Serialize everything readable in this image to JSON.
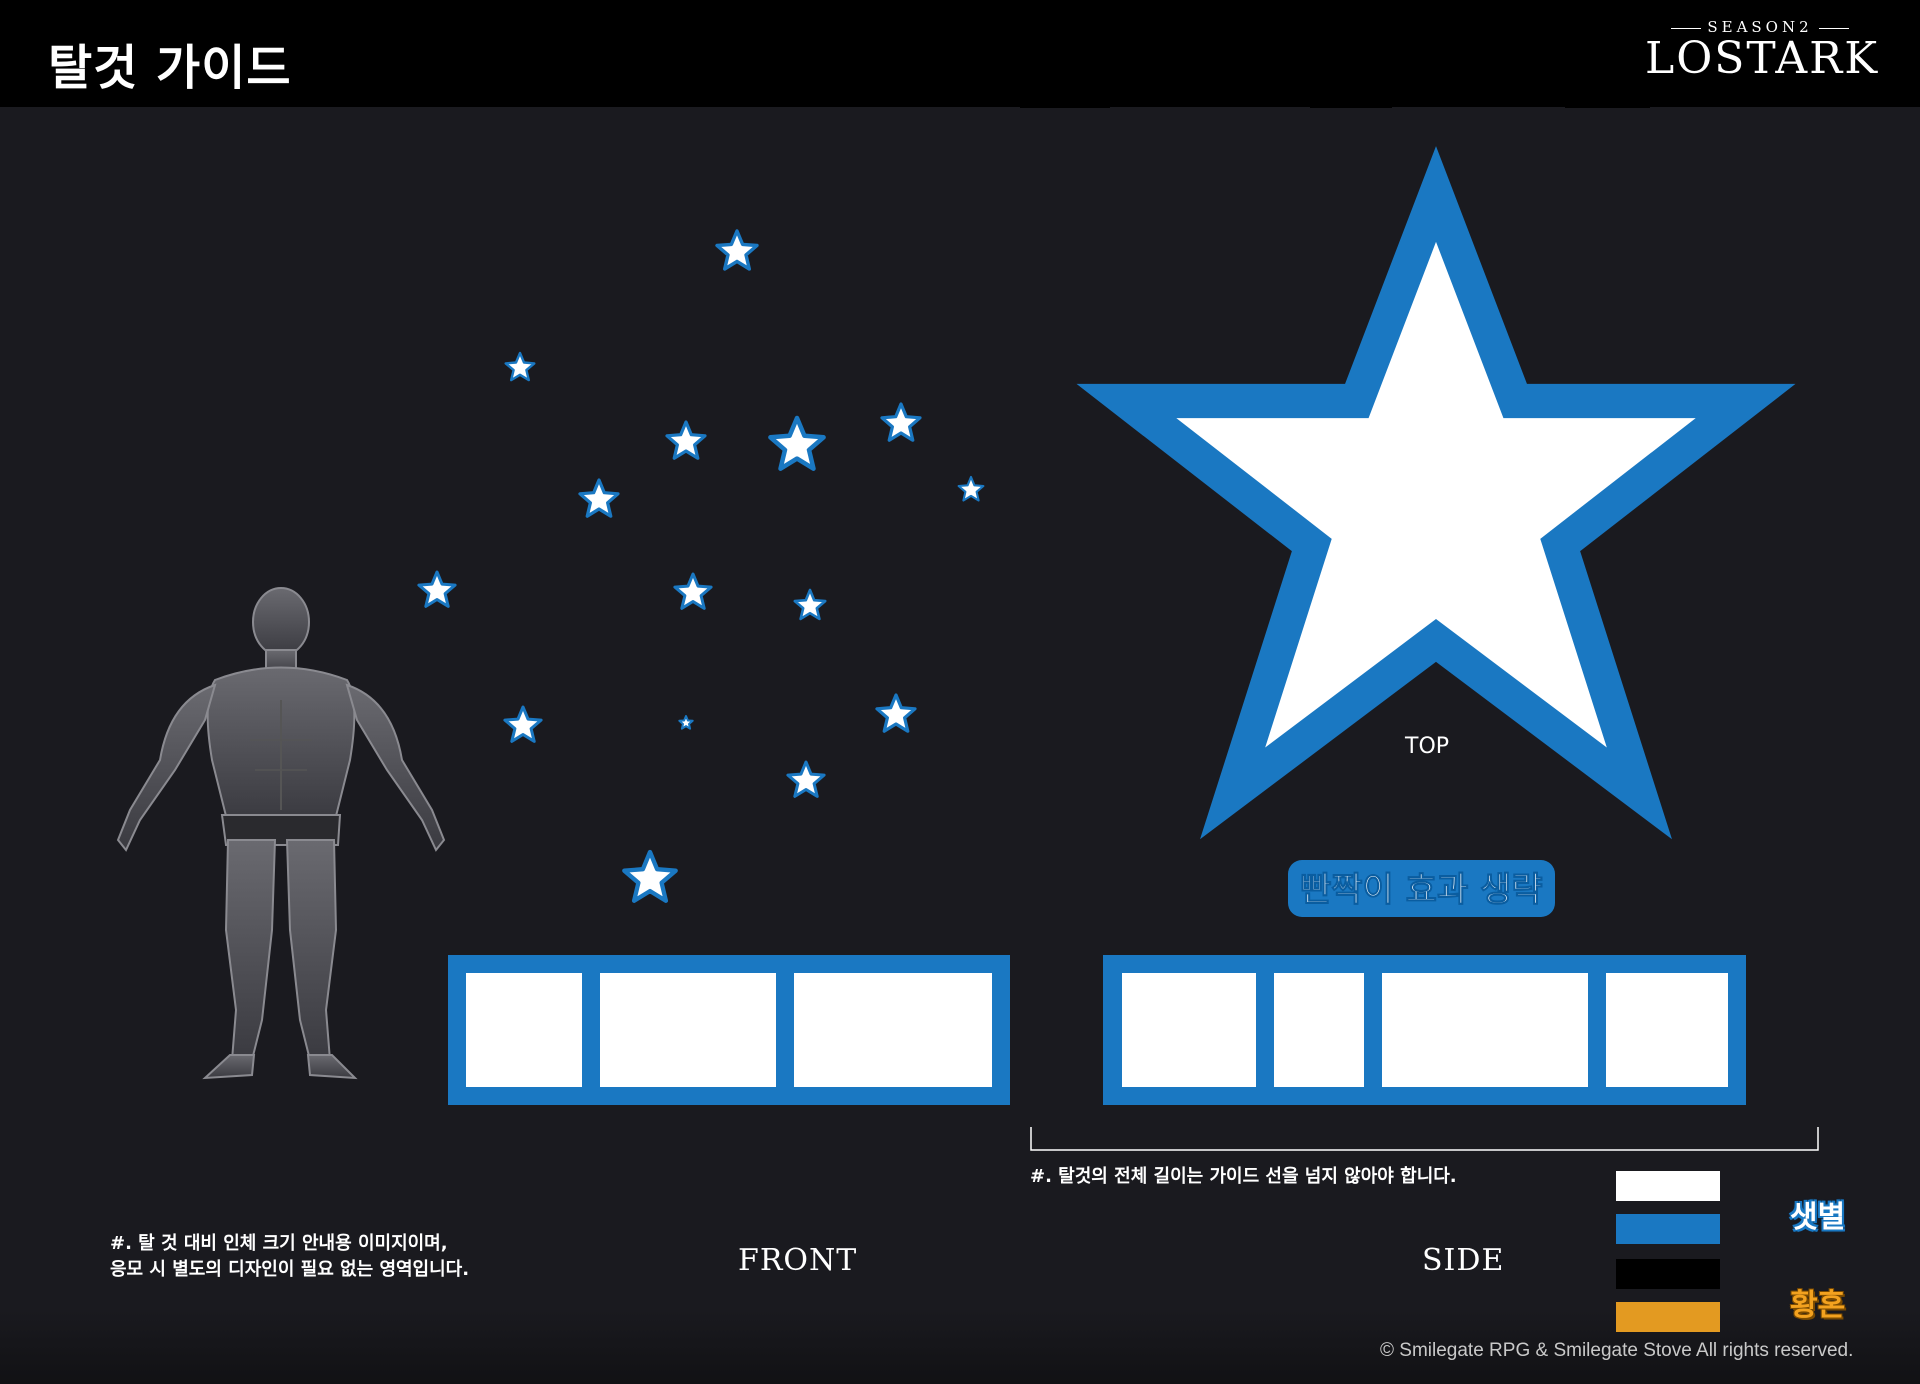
{
  "header": {
    "title": "탈것 가이드",
    "logo": {
      "season": "SEASON2",
      "wordmark": "LOSTARK"
    }
  },
  "views": {
    "top_label": "TOP",
    "front_label": "FRONT",
    "side_label": "SIDE"
  },
  "notes": {
    "omit_sparkle": "빤짝이 효과 생략",
    "guide_length": "#. 탈것의 전체 길이는 가이드 선을 넘지 않아야 합니다.",
    "human_scale_line1": "#. 탈 것 대비 인체 크기 안내용 이미지이며,",
    "human_scale_line2": "응모 시 별도의 디자인이 필요 없는 영역입니다."
  },
  "legend": {
    "items": [
      {
        "color": "#ffffff",
        "label": "샛별"
      },
      {
        "color": "#1a78c2",
        "label": ""
      },
      {
        "color": "#000000",
        "label": "황혼"
      },
      {
        "color": "#e39a21",
        "label": ""
      }
    ],
    "group_labels": [
      "샛별",
      "황혼"
    ]
  },
  "colors": {
    "background": "#1a1a1f",
    "header": "#000000",
    "accent_blue": "#1a78c2",
    "white": "#ffffff",
    "orange": "#e39a21"
  },
  "icons": {
    "reference_figure": "human-reference-figure",
    "small_stars": "star-icon",
    "top_view": "large-star-shape"
  },
  "footer": {
    "copyright": "© Smilegate RPG & Smilegate Stove All rights reserved."
  }
}
